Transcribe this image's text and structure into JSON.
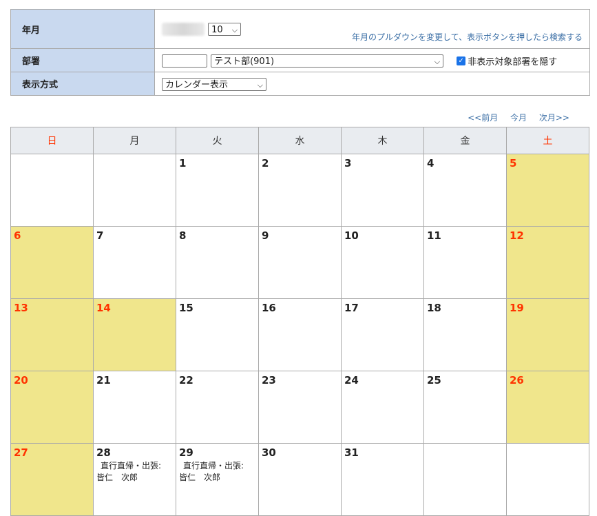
{
  "form": {
    "year_month_label": "年月",
    "month_value": "10",
    "hint": "年月のプルダウンを変更して、表示ボタンを押したら検索する",
    "dept_label": "部署",
    "dept_code_value": "",
    "dept_select_value": "テスト部(901)",
    "hide_checkbox_checked": true,
    "hide_checkbox_label": "非表示対象部署を隠す",
    "display_label": "表示方式",
    "display_select_value": "カレンダー表示"
  },
  "nav": {
    "prev": "<<前月",
    "current": "今月",
    "next": "次月>>"
  },
  "calendar": {
    "weekdays": [
      "日",
      "月",
      "火",
      "水",
      "木",
      "金",
      "土"
    ],
    "weeks": [
      [
        {
          "d": ""
        },
        {
          "d": ""
        },
        {
          "d": "1"
        },
        {
          "d": "2"
        },
        {
          "d": "3"
        },
        {
          "d": "4"
        },
        {
          "d": "5",
          "hol": true
        }
      ],
      [
        {
          "d": "6",
          "hol": true
        },
        {
          "d": "7"
        },
        {
          "d": "8"
        },
        {
          "d": "9"
        },
        {
          "d": "10"
        },
        {
          "d": "11"
        },
        {
          "d": "12",
          "hol": true
        }
      ],
      [
        {
          "d": "13",
          "hol": true
        },
        {
          "d": "14",
          "hol": true
        },
        {
          "d": "15"
        },
        {
          "d": "16"
        },
        {
          "d": "17"
        },
        {
          "d": "18"
        },
        {
          "d": "19",
          "hol": true
        }
      ],
      [
        {
          "d": "20",
          "hol": true
        },
        {
          "d": "21"
        },
        {
          "d": "22"
        },
        {
          "d": "23"
        },
        {
          "d": "24"
        },
        {
          "d": "25"
        },
        {
          "d": "26",
          "hol": true
        }
      ],
      [
        {
          "d": "27",
          "hol": true
        },
        {
          "d": "28",
          "ev": [
            "直行直帰・出張:",
            "皆仁　次郎"
          ]
        },
        {
          "d": "29",
          "ev": [
            "直行直帰・出張:",
            "皆仁　次郎"
          ]
        },
        {
          "d": "30"
        },
        {
          "d": "31"
        },
        {
          "d": ""
        },
        {
          "d": ""
        }
      ]
    ]
  },
  "colors": {
    "label_bg": "#c9d9ef",
    "holiday_bg": "#f0e68c",
    "weekend_text": "#ff3300",
    "link": "#3a6ea5"
  }
}
